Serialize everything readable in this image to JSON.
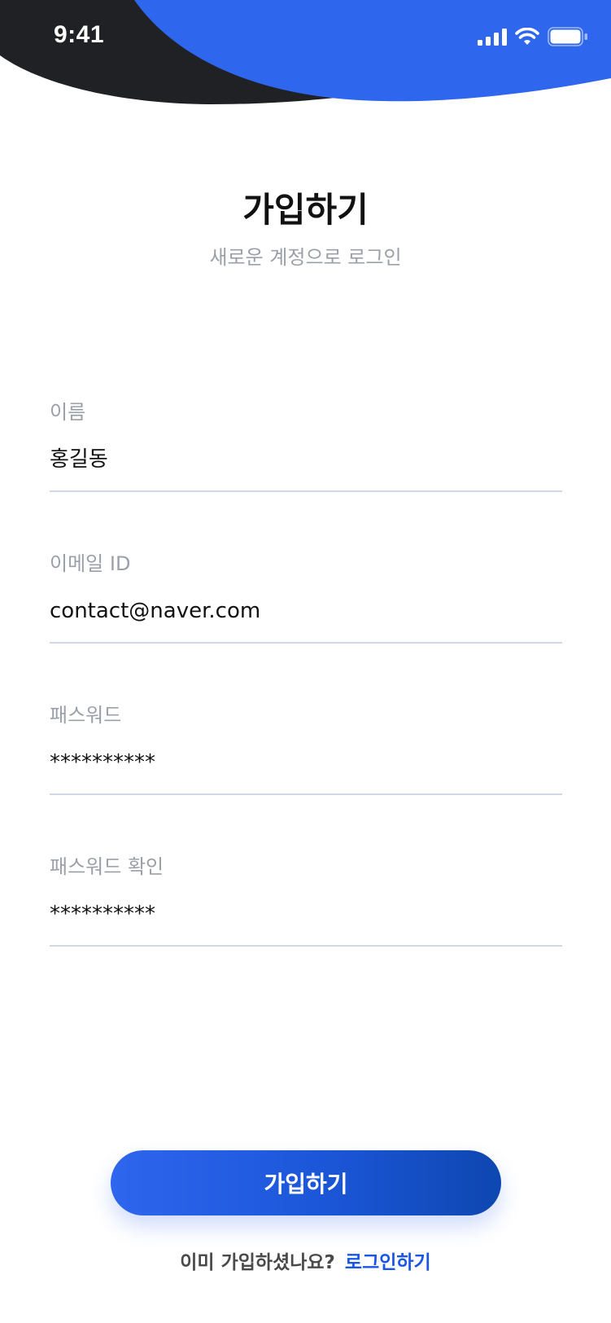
{
  "status_bar": {
    "time": "9:41",
    "signal_icon": "cellular-signal-icon",
    "wifi_icon": "wifi-icon",
    "battery_icon": "battery-icon"
  },
  "header": {
    "title": "가입하기",
    "subtitle": "새로운 계정으로 로그인"
  },
  "form": {
    "fields": [
      {
        "label": "이름",
        "value": "홍길동"
      },
      {
        "label": "이메일 ID",
        "value": "contact@naver.com"
      },
      {
        "label": "패스워드",
        "value": "**********"
      },
      {
        "label": "패스워드 확인",
        "value": "**********"
      }
    ]
  },
  "actions": {
    "signup_label": "가입하기"
  },
  "footer": {
    "question": "이미 가입하셨나요?",
    "login_link": "로그인하기"
  },
  "colors": {
    "accent": "#2e66ee",
    "header_dark": "#202124",
    "link": "#1a56e6",
    "muted_text": "#9a9fa8",
    "underline": "#d3d6e8"
  }
}
